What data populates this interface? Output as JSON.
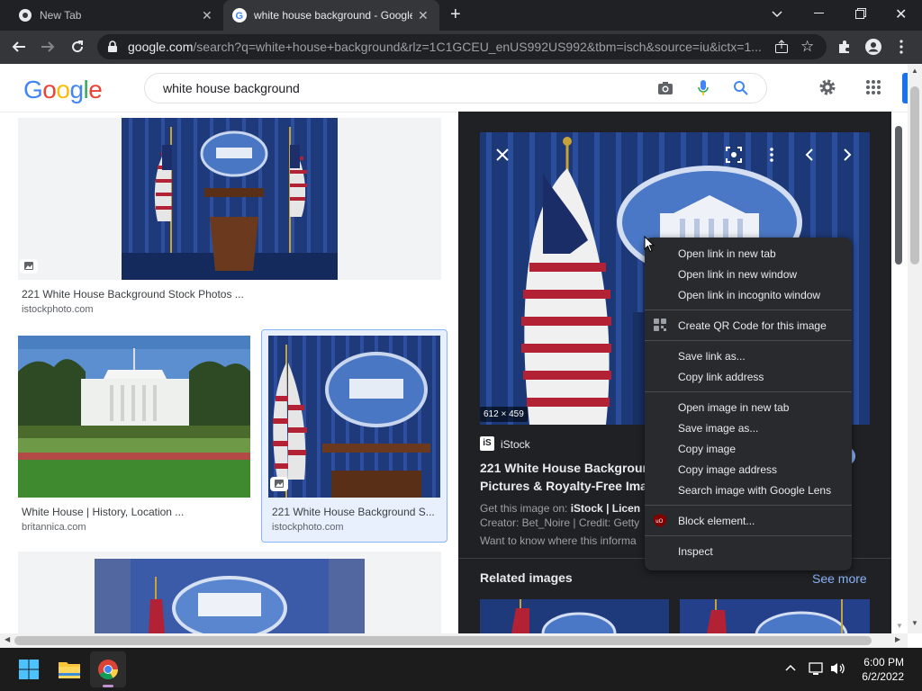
{
  "tabs": [
    {
      "title": "New Tab",
      "active": false
    },
    {
      "title": "white house background - Google",
      "active": true
    }
  ],
  "toolbar": {
    "url_host": "google.com",
    "url_rest": "/search?q=white+house+background&rlz=1C1GCEU_enUS992US992&tbm=isch&source=iu&ictx=1..."
  },
  "google": {
    "logo_letters": [
      {
        "ch": "G",
        "color": "#4285f4"
      },
      {
        "ch": "o",
        "color": "#ea4335"
      },
      {
        "ch": "o",
        "color": "#fbbc05"
      },
      {
        "ch": "g",
        "color": "#4285f4"
      },
      {
        "ch": "l",
        "color": "#34a853"
      },
      {
        "ch": "e",
        "color": "#ea4335"
      }
    ],
    "query": "white house background"
  },
  "results": [
    {
      "title": "221 White House Background Stock Photos ...",
      "site": "istockphoto.com"
    },
    {
      "title": "White House | History, Location ...",
      "site": "britannica.com"
    },
    {
      "title": "221 White House Background S...",
      "site": "istockphoto.com"
    }
  ],
  "preview": {
    "dimensions": "612 × 459",
    "source_name": "iStock",
    "title_line1": "221 White House Backgrour",
    "title_line2": "Pictures & Royalty-Free Ima",
    "get_image_prefix": "Get this image on: ",
    "get_image_source": "iStock | Licen",
    "creator": "Creator: Bet_Noire | Credit: Getty",
    "want_to_know": "Want to know where this informa",
    "related_heading": "Related images",
    "see_more": "See more"
  },
  "context_menu": {
    "groups": [
      [
        "Open link in new tab",
        "Open link in new window",
        "Open link in incognito window"
      ],
      [
        "Create QR Code for this image"
      ],
      [
        "Save link as...",
        "Copy link address"
      ],
      [
        "Open image in new tab",
        "Save image as...",
        "Copy image",
        "Copy image address",
        "Search image with Google Lens"
      ],
      [
        "Block element..."
      ],
      [
        "Inspect"
      ]
    ]
  },
  "taskbar": {
    "time": "6:00 PM",
    "date": "6/2/2022"
  },
  "colors": {
    "accent": "#1a73e8",
    "dark_panel": "#202124",
    "menu_bg": "#292a2d",
    "menu_text": "#e8eaed"
  }
}
